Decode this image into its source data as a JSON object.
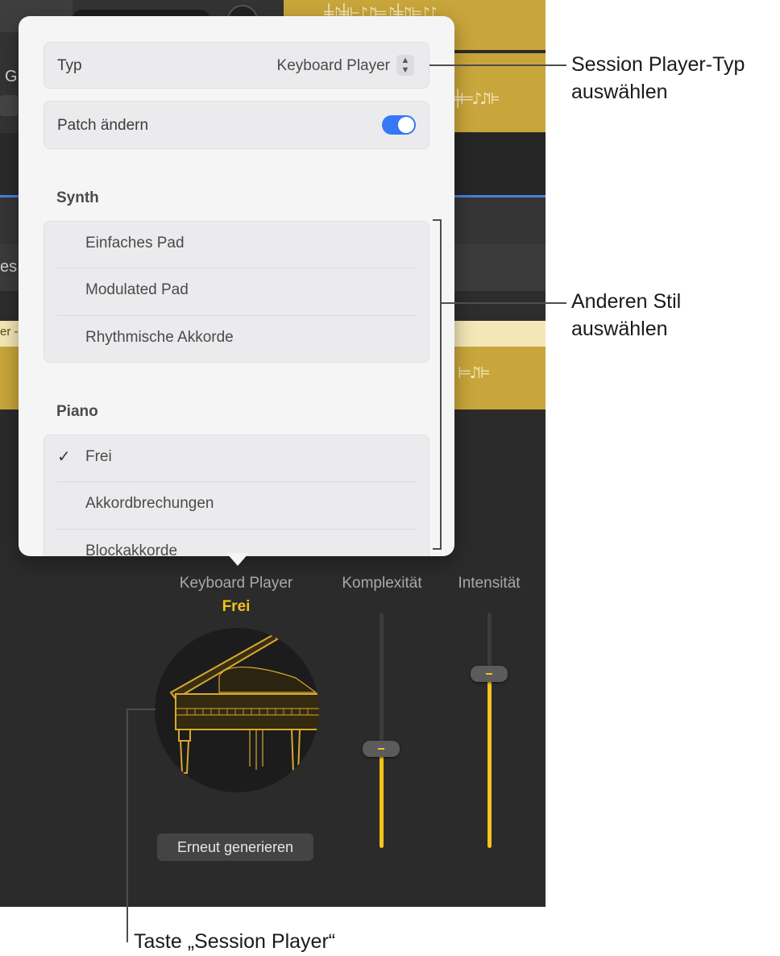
{
  "popover": {
    "type_row": {
      "label": "Typ",
      "value": "Keyboard Player"
    },
    "patch_row": {
      "label": "Patch ändern",
      "enabled": true
    },
    "sections": [
      {
        "heading": "Synth",
        "items": [
          "Einfaches Pad",
          "Modulated Pad",
          "Rhythmische Akkorde"
        ]
      },
      {
        "heading": "Piano",
        "items": [
          "Frei",
          "Akkordbrechungen",
          "Blockakkorde"
        ],
        "selected_index": 0
      }
    ],
    "checkmark": "✓"
  },
  "background": {
    "edge_text_top": "G",
    "edge_text_mid": "es",
    "edge_text_ruler": "er -"
  },
  "player": {
    "title": "Keyboard Player",
    "style": "Frei",
    "complexity_label": "Komplexität",
    "intensity_label": "Intensität",
    "complexity_value": 0.42,
    "intensity_value": 0.74,
    "regenerate_label": "Erneut generieren"
  },
  "callouts": {
    "type": {
      "line1": "Session Player-Typ",
      "line2": "auswählen"
    },
    "style": {
      "line1": "Anderen Stil",
      "line2": "auswählen"
    },
    "button": {
      "text": "Taste „Session Player“"
    }
  },
  "colors": {
    "accent_gold": "#f3c51a",
    "toggle_blue": "#3478f6",
    "region_gold": "#c9a63b"
  }
}
